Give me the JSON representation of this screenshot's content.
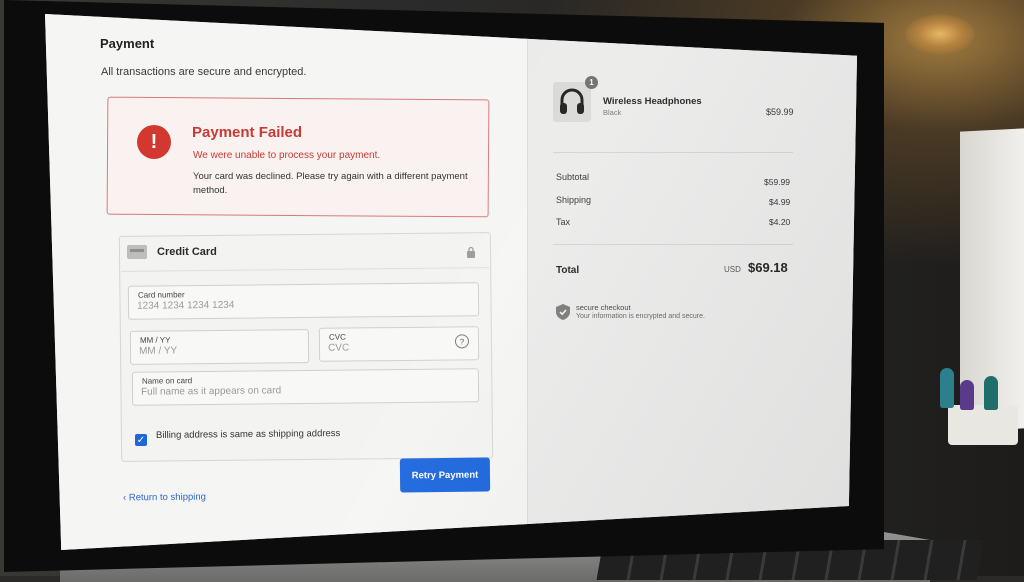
{
  "header": {
    "title": "Payment",
    "subtitle": "All transactions are secure and encrypted."
  },
  "alert": {
    "icon": "!",
    "title": "Payment Failed",
    "message": "We were unable to process your payment.",
    "detail": "Your card was declined. Please try again with a different payment method."
  },
  "card_section": {
    "title": "Credit Card",
    "card_number": {
      "label": "Card number",
      "placeholder": "1234 1234 1234 1234",
      "value": ""
    },
    "expiry": {
      "label": "MM / YY",
      "placeholder": "MM / YY",
      "value": ""
    },
    "cvc": {
      "label": "CVC",
      "placeholder": "CVC",
      "value": "",
      "help": "?"
    },
    "name": {
      "label": "Name on card",
      "placeholder": "Full name as it appears on card",
      "value": ""
    },
    "billing_same": {
      "label": "Billing address is same as shipping address",
      "checked": true
    }
  },
  "actions": {
    "retry_label": "Retry Payment",
    "back_label": "‹ Return to shipping"
  },
  "summary": {
    "product": {
      "name": "Wireless Headphones",
      "variant": "Black",
      "price": "$59.99",
      "quantity": "1",
      "icon": "headphones-icon"
    },
    "rows": [
      {
        "label": "Subtotal",
        "value": "$59.99"
      },
      {
        "label": "Shipping",
        "value": "$4.99"
      },
      {
        "label": "Tax",
        "value": "$4.20"
      }
    ],
    "total": {
      "label": "Total",
      "currency": "USD",
      "value": "$69.18"
    },
    "secure": {
      "title": "secure checkout",
      "subtitle": "Your information is encrypted and secure."
    }
  },
  "colors": {
    "accent": "#1864dd",
    "error": "#d2382f",
    "link": "#2a68c9"
  }
}
